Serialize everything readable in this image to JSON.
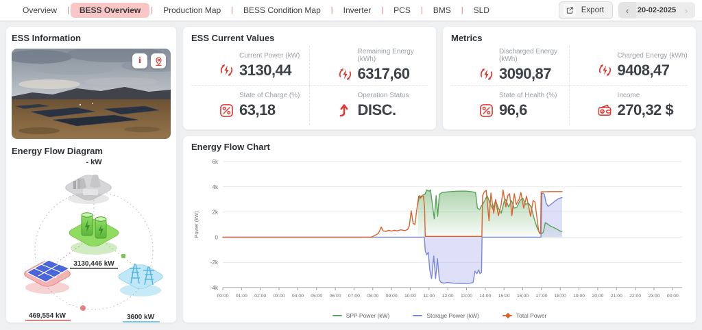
{
  "header": {
    "nav": [
      {
        "label": "Overview",
        "active": false
      },
      {
        "label": "BESS Overview",
        "active": true
      },
      {
        "label": "Production Map",
        "active": false
      },
      {
        "label": "BESS Condition Map",
        "active": false
      },
      {
        "label": "Inverter",
        "active": false
      },
      {
        "label": "PCS",
        "active": false
      },
      {
        "label": "BMS",
        "active": false
      },
      {
        "label": "SLD",
        "active": false
      }
    ],
    "separator": "|",
    "export_label": "Export",
    "date": "20-02-2025",
    "prev": "‹",
    "next": "›"
  },
  "ess_info": {
    "title": "ESS Information",
    "photo_buttons": [
      {
        "icon": "info"
      },
      {
        "icon": "pin"
      }
    ]
  },
  "flow_diagram": {
    "title": "Energy Flow Diagram",
    "grid_label": "- kW",
    "battery_label": "3130,446 kW",
    "solar_label": "469,554 kW",
    "tower_label": "3600 kW",
    "colors": {
      "battery": "#6cc04a",
      "solar": "#e05252",
      "tower": "#46b8e0",
      "grid": "#9e9e9e"
    }
  },
  "ess_current": {
    "title": "ESS Current Values",
    "items": [
      {
        "label": "Current Power (kW)",
        "value": "3130,44",
        "icon": "energy-cycle"
      },
      {
        "label": "Remaining Energy (kWh)",
        "value": "6317,60",
        "icon": "energy-cycle"
      },
      {
        "label": "State of Charge (%)",
        "value": "63,18",
        "icon": "percent"
      },
      {
        "label": "Operation Status",
        "value": "DISC.",
        "icon": "arrow-up"
      }
    ]
  },
  "metrics": {
    "title": "Metrics",
    "items": [
      {
        "label": "Discharged Energy (kWh)",
        "value": "3090,87",
        "icon": "energy-cycle"
      },
      {
        "label": "Charged Energy (kWh)",
        "value": "9408,47",
        "icon": "energy-cycle"
      },
      {
        "label": "State of Health (%)",
        "value": "96,6",
        "icon": "percent"
      },
      {
        "label": "Income",
        "value": "270,32 $",
        "icon": "wallet"
      }
    ]
  },
  "accent_color": "#e03a34",
  "chart_data": {
    "type": "line",
    "title": "Energy Flow Chart",
    "ylabel": "Power (kW)",
    "ylim": [
      -4000,
      6000
    ],
    "x_range_hours": [
      0,
      24.5
    ],
    "grid": true,
    "legend_position": "bottom",
    "y_ticks": [
      {
        "v": 6000,
        "label": "6k"
      },
      {
        "v": 4000,
        "label": "4k"
      },
      {
        "v": 2000,
        "label": "2k"
      },
      {
        "v": 0,
        "label": "0"
      },
      {
        "v": -2000,
        "label": "-2k"
      },
      {
        "v": -4000,
        "label": "-4k"
      }
    ],
    "x_ticks": [
      "00:00",
      "01:00",
      "02:00",
      "03:00",
      "04:00",
      "05:00",
      "06:00",
      "07:00",
      "08:00",
      "09:00",
      "10:00",
      "11:00",
      "12:00",
      "13:00",
      "14:00",
      "15:00",
      "16:00",
      "17:00",
      "18:00",
      "19:00",
      "20:00",
      "21:00",
      "22:00",
      "23:00",
      "00:00"
    ],
    "series": [
      {
        "name": "SPP Power (kW)",
        "color": "#57a35a",
        "fill": "green-gradient",
        "marker": "line",
        "points": [
          [
            10.4,
            2600
          ],
          [
            10.5,
            3300
          ],
          [
            10.6,
            3200
          ],
          [
            10.68,
            3350
          ],
          [
            10.78,
            3400
          ],
          [
            10.88,
            3750
          ],
          [
            11,
            3650
          ],
          [
            11.08,
            3750
          ],
          [
            11.18,
            2600
          ],
          [
            11.28,
            1450
          ],
          [
            11.38,
            3300
          ],
          [
            11.46,
            1650
          ],
          [
            11.55,
            3400
          ],
          [
            11.7,
            3550
          ],
          [
            12,
            3600
          ],
          [
            12.5,
            3650
          ],
          [
            13,
            3650
          ],
          [
            13.3,
            3600
          ],
          [
            13.48,
            3550
          ],
          [
            13.58,
            2300
          ],
          [
            13.7,
            2200
          ],
          [
            13.8,
            2500
          ],
          [
            13.9,
            2700
          ],
          [
            14,
            3000
          ],
          [
            14.1,
            3300
          ],
          [
            14.25,
            2700
          ],
          [
            14.4,
            2250
          ],
          [
            14.55,
            2900
          ],
          [
            14.7,
            2300
          ],
          [
            14.85,
            1900
          ],
          [
            15,
            2800
          ],
          [
            15.1,
            3000
          ],
          [
            15.25,
            2400
          ],
          [
            15.4,
            2900
          ],
          [
            15.55,
            2300
          ],
          [
            15.7,
            2400
          ],
          [
            15.85,
            2900
          ],
          [
            16,
            3100
          ],
          [
            16.15,
            2600
          ],
          [
            16.3,
            2700
          ],
          [
            16.45,
            2400
          ],
          [
            16.6,
            1500
          ],
          [
            16.75,
            800
          ],
          [
            16.9,
            300
          ],
          [
            17,
            250
          ],
          [
            17.1,
            400
          ],
          [
            17.2,
            1150
          ],
          [
            17.32,
            1050
          ],
          [
            17.45,
            900
          ],
          [
            17.6,
            800
          ],
          [
            17.8,
            650
          ],
          [
            18,
            480
          ],
          [
            18.1,
            470
          ]
        ]
      },
      {
        "name": "Storage Power (kW)",
        "color": "#7b88d8",
        "fill": "rgba(132,143,222,0.28)",
        "marker": "line",
        "points": [
          [
            0,
            0
          ],
          [
            10.75,
            0
          ],
          [
            10.8,
            -1100
          ],
          [
            10.88,
            -1400
          ],
          [
            10.96,
            -1200
          ],
          [
            11.04,
            -2600
          ],
          [
            11.14,
            -3300
          ],
          [
            11.25,
            -1500
          ],
          [
            11.35,
            -3300
          ],
          [
            11.45,
            -1700
          ],
          [
            11.55,
            -3400
          ],
          [
            11.65,
            -3600
          ],
          [
            11.8,
            -3650
          ],
          [
            12,
            -3600
          ],
          [
            12.3,
            -3650
          ],
          [
            12.7,
            -3680
          ],
          [
            13,
            -3680
          ],
          [
            13.2,
            -3650
          ],
          [
            13.35,
            -3600
          ],
          [
            13.45,
            -2700
          ],
          [
            13.55,
            -2900
          ],
          [
            13.65,
            -2600
          ],
          [
            13.72,
            -2900
          ],
          [
            13.8,
            -2800
          ],
          [
            13.83,
            0
          ],
          [
            16.97,
            0
          ],
          [
            17.02,
            3450
          ],
          [
            17.08,
            3500
          ],
          [
            17.15,
            3400
          ],
          [
            17.25,
            2700
          ],
          [
            17.35,
            2450
          ],
          [
            17.5,
            2600
          ],
          [
            17.7,
            2850
          ],
          [
            17.9,
            3050
          ],
          [
            18.05,
            3130
          ],
          [
            18.1,
            3130
          ]
        ]
      },
      {
        "name": "Total Power",
        "color": "#df6029",
        "fill": null,
        "marker": "diamond",
        "points": [
          [
            0,
            0
          ],
          [
            7.9,
            0
          ],
          [
            8.1,
            120
          ],
          [
            8.3,
            300
          ],
          [
            8.45,
            800
          ],
          [
            8.55,
            500
          ],
          [
            8.7,
            450
          ],
          [
            8.85,
            550
          ],
          [
            9,
            480
          ],
          [
            9.15,
            550
          ],
          [
            9.3,
            500
          ],
          [
            9.5,
            580
          ],
          [
            9.7,
            520
          ],
          [
            9.85,
            600
          ],
          [
            9.95,
            900
          ],
          [
            10.05,
            2100
          ],
          [
            10.15,
            1100
          ],
          [
            10.25,
            1000
          ],
          [
            10.35,
            2200
          ],
          [
            10.45,
            3250
          ],
          [
            10.55,
            3100
          ],
          [
            10.62,
            3300
          ],
          [
            10.7,
            3250
          ],
          [
            10.76,
            2400
          ],
          [
            10.8,
            60
          ],
          [
            13.82,
            60
          ],
          [
            13.86,
            3300
          ],
          [
            13.95,
            3600
          ],
          [
            14.05,
            3720
          ],
          [
            14.2,
            1300
          ],
          [
            14.3,
            3500
          ],
          [
            14.45,
            1900
          ],
          [
            14.55,
            3000
          ],
          [
            14.7,
            1700
          ],
          [
            14.85,
            2600
          ],
          [
            14.95,
            3750
          ],
          [
            15.1,
            2400
          ],
          [
            15.2,
            3300
          ],
          [
            15.3,
            3450
          ],
          [
            15.42,
            1700
          ],
          [
            15.55,
            3450
          ],
          [
            15.65,
            2600
          ],
          [
            15.8,
            3000
          ],
          [
            15.9,
            3550
          ],
          [
            16.05,
            2300
          ],
          [
            16.2,
            3250
          ],
          [
            16.3,
            2500
          ],
          [
            16.42,
            1650
          ],
          [
            16.55,
            2900
          ],
          [
            16.65,
            2800
          ],
          [
            16.75,
            1600
          ],
          [
            16.85,
            450
          ],
          [
            16.95,
            300
          ],
          [
            16.98,
            3600
          ],
          [
            17.5,
            3620
          ],
          [
            18.05,
            3620
          ],
          [
            18.1,
            3620
          ]
        ]
      }
    ]
  }
}
